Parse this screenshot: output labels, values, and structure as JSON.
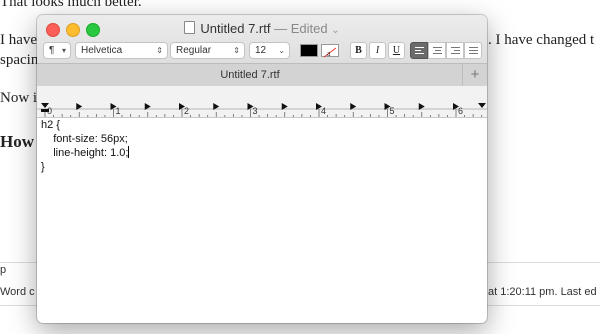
{
  "background": {
    "lines": [
      "That looks much better.",
      "I have",
      ". I have changed t",
      "spacin",
      "Now i",
      "How"
    ],
    "footer_left": [
      "p",
      "Word c"
    ],
    "footer_right": "at 1:20:11 pm. Last ed"
  },
  "window": {
    "title": "Untitled 7.rtf",
    "title_status": "— Edited",
    "toolbar": {
      "paragraph_styles": "¶",
      "font_family": "Helvetica",
      "typeface": "Regular",
      "font_size": "12",
      "bold": "B",
      "italic": "I",
      "underline": "U",
      "text_color": "#000000"
    },
    "tab_label": "Untitled 7.rtf",
    "ruler_numbers": [
      "0",
      "1",
      "2",
      "3",
      "4",
      "5",
      "6"
    ],
    "content": [
      "h2 {",
      "    font-size: 56px;",
      "    line-height: 1.0;",
      "}"
    ]
  }
}
